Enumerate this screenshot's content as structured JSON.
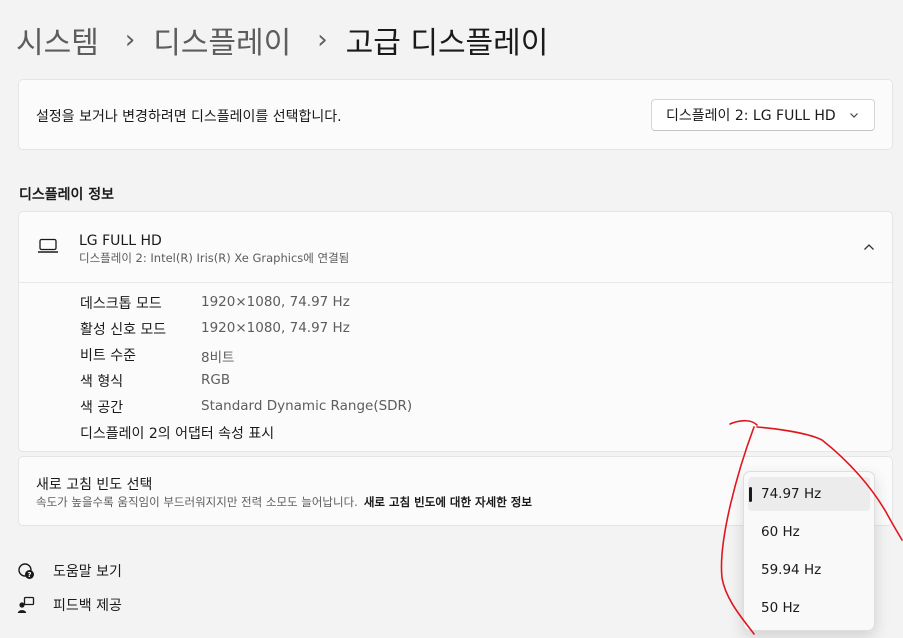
{
  "breadcrumb": {
    "item1": "시스템",
    "item2": "디스플레이",
    "current": "고급 디스플레이"
  },
  "selector": {
    "prompt": "설정을 보거나 변경하려면 디스플레이를 선택합니다.",
    "value": "디스플레이 2: LG FULL HD"
  },
  "info": {
    "section_title": "디스플레이 정보",
    "display_name": "LG FULL HD",
    "display_subtitle": "디스플레이 2: Intel(R) Iris(R) Xe Graphics에 연결됨",
    "properties": [
      {
        "label": "데스크톱 모드",
        "value": "1920×1080, 74.97 Hz"
      },
      {
        "label": "활성 신호 모드",
        "value": "1920×1080, 74.97 Hz"
      },
      {
        "label": "비트 수준",
        "value": "8비트"
      },
      {
        "label": "색 형식",
        "value": "RGB"
      },
      {
        "label": "색 공간",
        "value": "Standard Dynamic Range(SDR)"
      }
    ],
    "adapter_link": "디스플레이 2의 어댑터 속성 표시"
  },
  "refresh": {
    "title": "새로 고침 빈도 선택",
    "description": "속도가 높을수록 움직임이 부드러워지지만 전력 소모도 늘어납니다.",
    "learn_more": "새로 고침 빈도에 대한 자세한 정보",
    "options": [
      "74.97 Hz",
      "60 Hz",
      "59.94 Hz",
      "50 Hz"
    ],
    "selected": "74.97 Hz"
  },
  "footer": {
    "help": "도움말 보기",
    "feedback": "피드백 제공"
  },
  "icons": {
    "collapse": "chevron-up-icon",
    "dropdown": "chevron-down-icon",
    "display": "laptop-icon",
    "help": "help-icon",
    "feedback": "feedback-icon"
  },
  "colors": {
    "annotation_stroke": "#e0161e"
  }
}
